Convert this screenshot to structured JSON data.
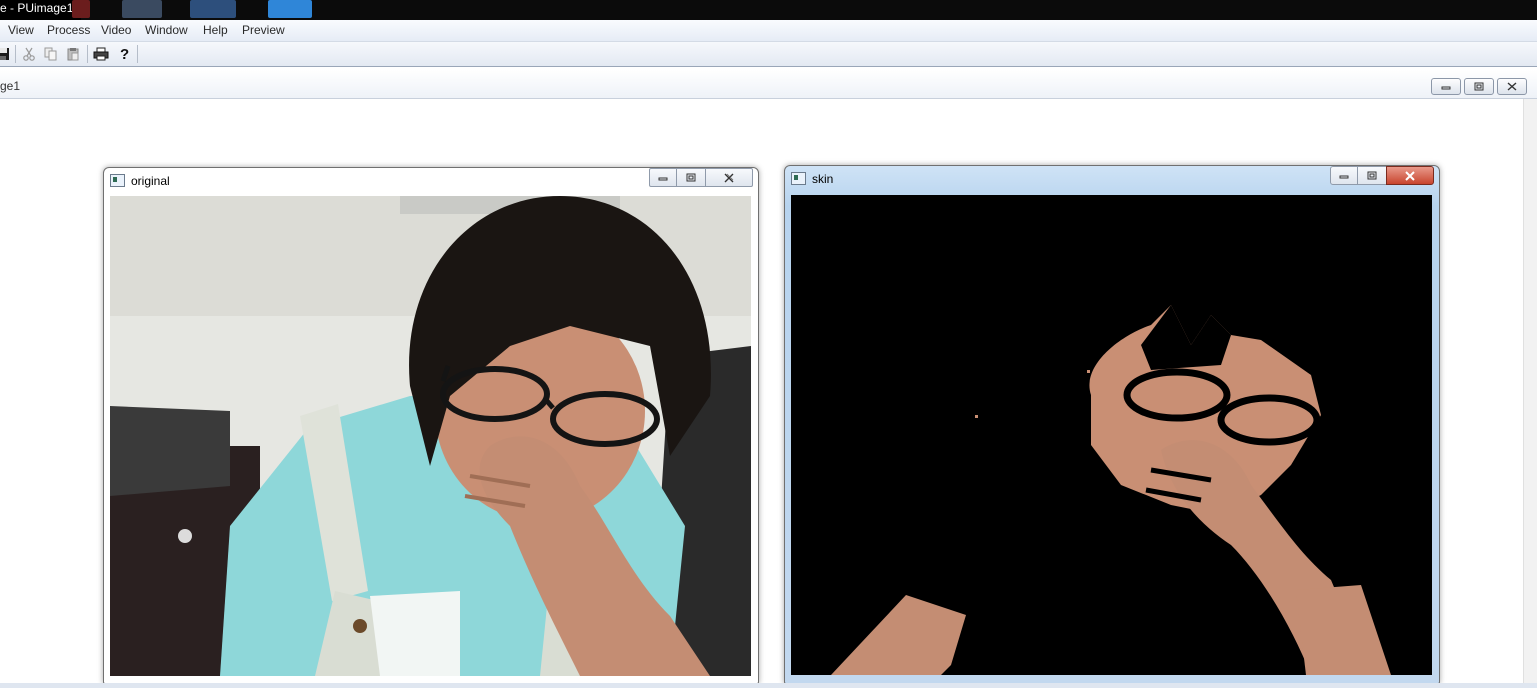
{
  "app": {
    "title": "e - PUimage1"
  },
  "menubar": {
    "items": [
      {
        "label": "View"
      },
      {
        "label": "Process"
      },
      {
        "label": "Video"
      },
      {
        "label": "Window"
      },
      {
        "label": "Help"
      },
      {
        "label": "Preview"
      }
    ]
  },
  "toolbar": {
    "icons": [
      "save-icon",
      "cut-icon",
      "copy-icon",
      "paste-icon",
      "print-icon",
      "help-icon"
    ]
  },
  "mdi": {
    "caption": "ge1"
  },
  "windows": {
    "original": {
      "title": "original"
    },
    "skin": {
      "title": "skin"
    }
  },
  "colors": {
    "titlebar": "#0b0b0b",
    "shirt": "#8ed7d9",
    "hair": "#1a1512",
    "skin_tone": "#c98f74",
    "skin_mask_background": "#000000"
  }
}
